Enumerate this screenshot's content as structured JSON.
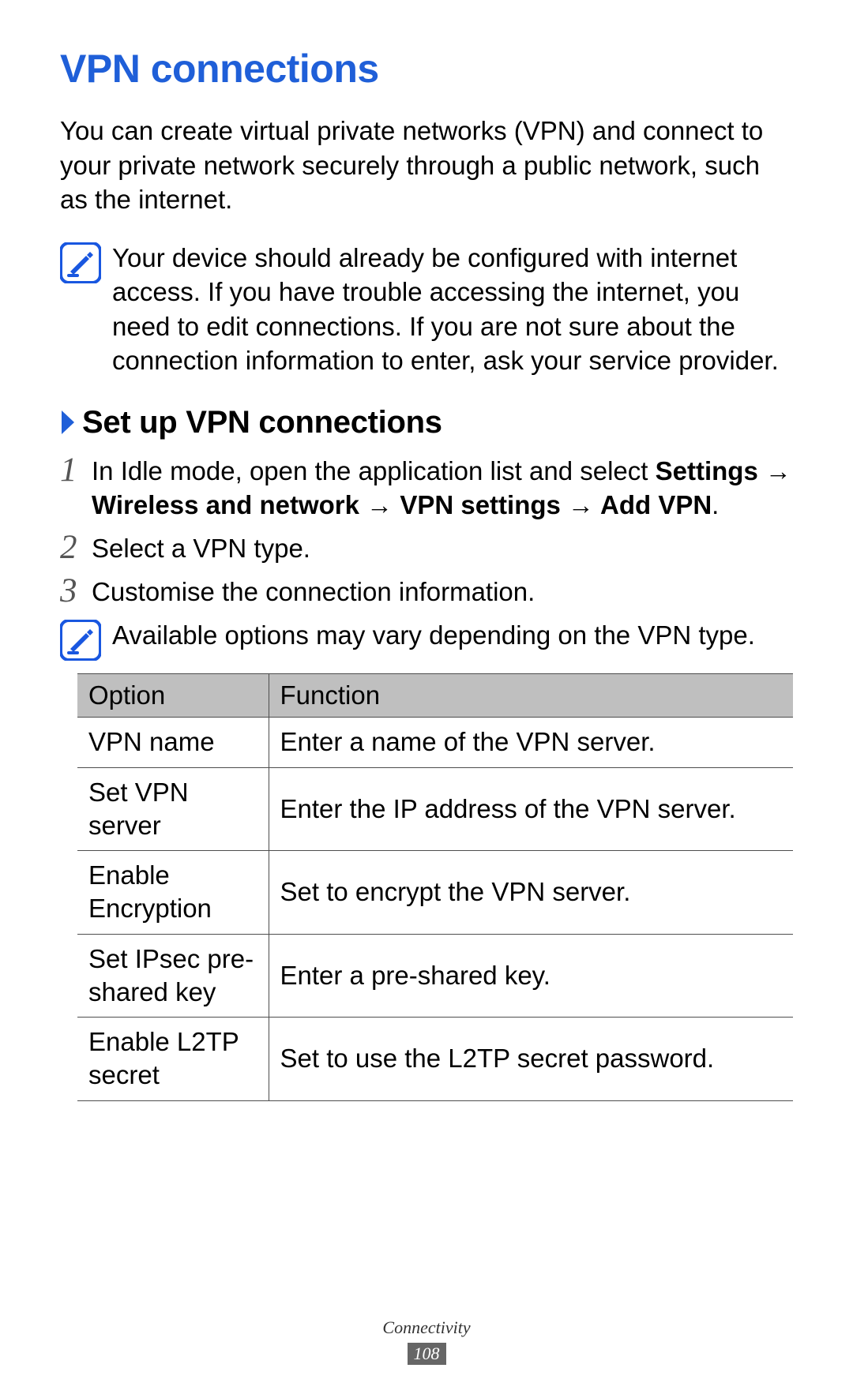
{
  "title": "VPN connections",
  "intro": "You can create virtual private networks (VPN) and connect to your private network securely through a public network, such as the internet.",
  "note1": "Your device should already be configured with internet access. If you have trouble accessing the internet, you need to edit connections. If you are not sure about the connection information to enter, ask your service provider.",
  "subheading": "Set up VPN connections",
  "steps": {
    "n1": "1",
    "s1_prefix": "In Idle mode, open the application list and select ",
    "s1_b1": "Settings",
    "s1_arrow": " → ",
    "s1_b2": "Wireless and network",
    "s1_b3": "VPN settings",
    "s1_b4": "Add VPN",
    "s1_period": ".",
    "n2": "2",
    "s2": "Select a VPN type.",
    "n3": "3",
    "s3": "Customise the connection information."
  },
  "note2": "Available options may vary depending on the VPN type.",
  "table": {
    "h_option": "Option",
    "h_function": "Function",
    "rows": [
      {
        "option": "VPN name",
        "function": "Enter a name of the VPN server."
      },
      {
        "option": "Set VPN server",
        "function": "Enter the IP address of the VPN server."
      },
      {
        "option": "Enable Encryption",
        "function": "Set to encrypt the VPN server."
      },
      {
        "option": "Set IPsec pre-shared key",
        "function": "Enter a pre-shared key."
      },
      {
        "option": "Enable L2TP secret",
        "function": "Set to use the L2TP secret password."
      }
    ]
  },
  "footer": {
    "section": "Connectivity",
    "page": "108"
  }
}
